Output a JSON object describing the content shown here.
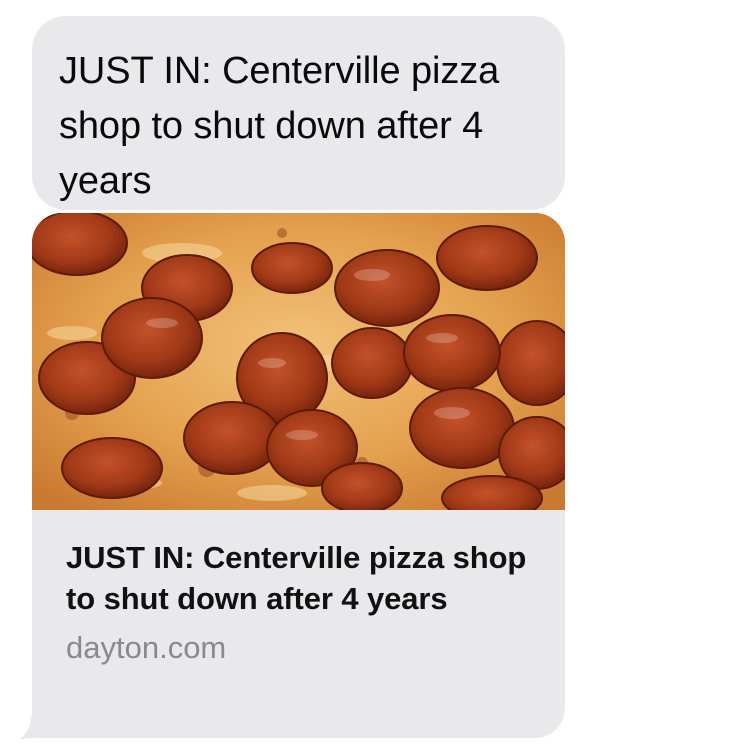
{
  "message": {
    "text": "JUST IN: Centerville pizza shop to shut down after 4 years"
  },
  "link_preview": {
    "image": "pepperoni-pizza-photo",
    "title": "JUST IN: Centerville pizza shop to shut down after 4 years",
    "domain": "dayton.com"
  },
  "colors": {
    "bubble": "#e9e9eb",
    "text": "#0a0a0a",
    "domain_text": "#8a8a8e",
    "cheese": "#e6a551",
    "pepperoni": "#a63a16"
  }
}
